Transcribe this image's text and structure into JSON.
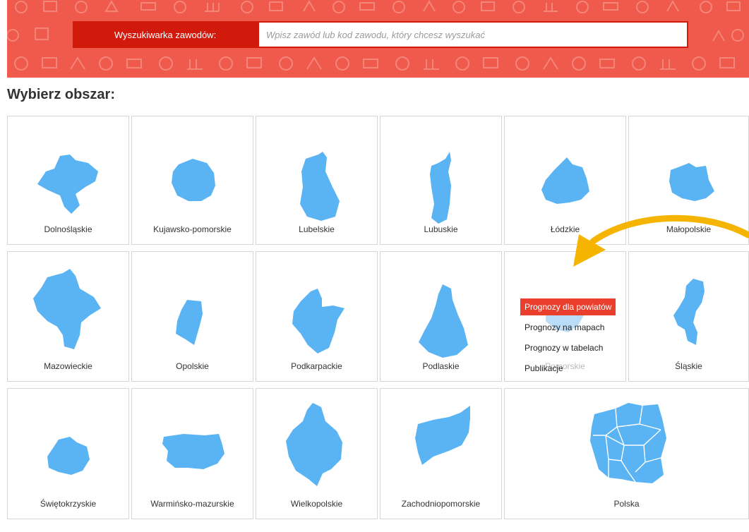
{
  "search": {
    "label": "Wyszukiwarka zawodów:",
    "placeholder": "Wpisz zawód lub kod zawodu, który chcesz wyszukać",
    "value": ""
  },
  "heading": "Wybierz obszar:",
  "regions": [
    "Dolnośląskie",
    "Kujawsko-pomorskie",
    "Lubelskie",
    "Lubuskie",
    "Łódzkie",
    "Małopolskie",
    "Mazowieckie",
    "Opolskie",
    "Podkarpackie",
    "Podlaskie",
    "Pomorskie",
    "Śląskie",
    "Świętokrzyskie",
    "Warmińsko-mazurskie",
    "Wielkopolskie",
    "Zachodniopomorskie",
    "Polska"
  ],
  "menu": {
    "items": [
      "Prognozy dla powiatów",
      "Prognozy na mapach",
      "Prognozy w tabelach",
      "Publikacje"
    ]
  },
  "colors": {
    "banner": "#ef5a4c",
    "label_bg": "#d21a0c",
    "region_fill": "#5ab4f4",
    "menu_active": "#ea3f2c",
    "arrow": "#f5b400"
  },
  "icons": [
    "cogs-icon",
    "chart-icon",
    "forklift-icon",
    "stethoscope-icon",
    "robot-icon",
    "truck-icon",
    "steering-wheel-icon",
    "bank-icon",
    "laptop-icon",
    "box-icon",
    "tractor-icon"
  ]
}
